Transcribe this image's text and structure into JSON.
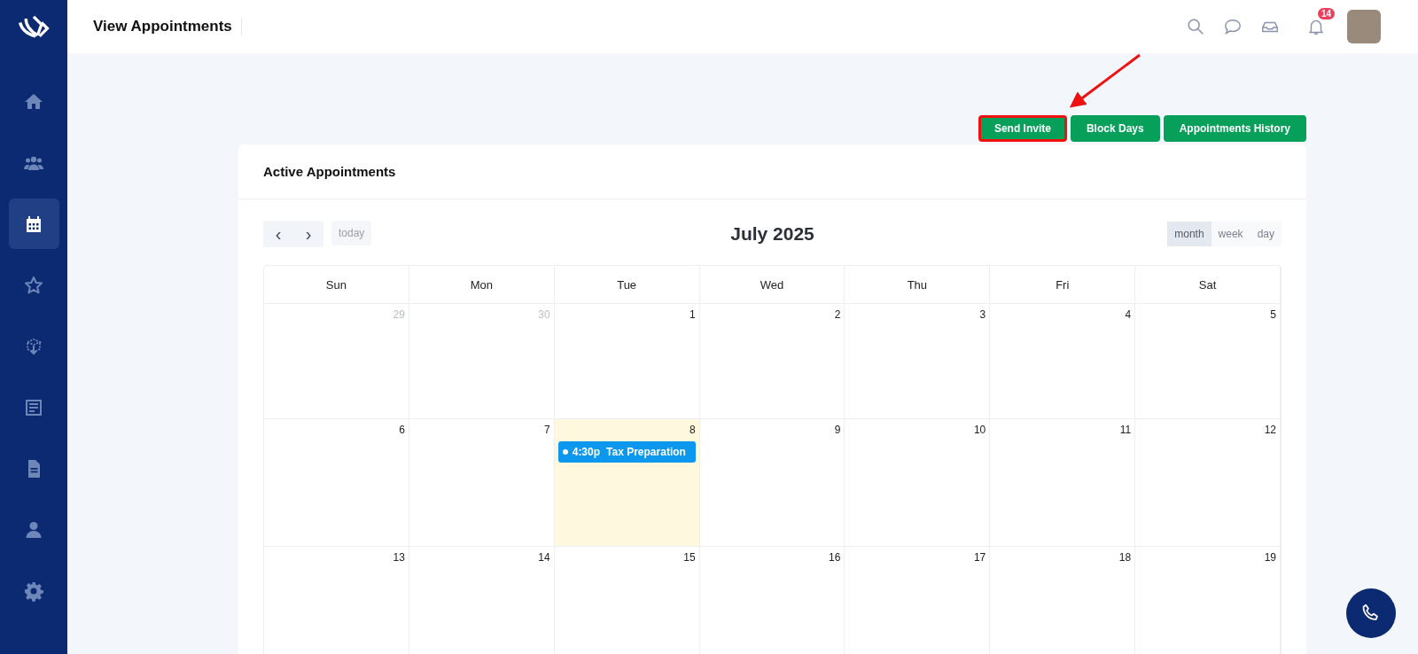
{
  "sidebar": {
    "items": [
      {
        "kind": "home",
        "selected": false
      },
      {
        "kind": "users",
        "selected": false
      },
      {
        "kind": "calendar",
        "selected": true
      },
      {
        "kind": "star",
        "selected": false
      },
      {
        "kind": "box",
        "selected": false
      },
      {
        "kind": "board",
        "selected": false
      },
      {
        "kind": "document",
        "selected": false
      },
      {
        "kind": "person",
        "selected": false
      },
      {
        "kind": "settings",
        "selected": false
      }
    ]
  },
  "header": {
    "title": "View Appointments",
    "notification_count": "14"
  },
  "actions": [
    {
      "label": "Send Invite",
      "highlighted": true
    },
    {
      "label": "Block Days",
      "highlighted": false
    },
    {
      "label": "Appointments History",
      "highlighted": false
    }
  ],
  "card": {
    "title": "Active Appointments"
  },
  "calendar": {
    "title": "July 2025",
    "prev": "‹",
    "next": "›",
    "today": "today",
    "views": [
      {
        "label": "month",
        "selected": true
      },
      {
        "label": "week",
        "selected": false
      },
      {
        "label": "day",
        "selected": false
      }
    ],
    "weekdays": [
      "Sun",
      "Mon",
      "Tue",
      "Wed",
      "Thu",
      "Fri",
      "Sat"
    ],
    "weeks": [
      [
        {
          "day": "29",
          "other_month": true,
          "today": false
        },
        {
          "day": "30",
          "other_month": true,
          "today": false
        },
        {
          "day": "1",
          "other_month": false,
          "today": false
        },
        {
          "day": "2",
          "other_month": false,
          "today": false
        },
        {
          "day": "3",
          "other_month": false,
          "today": false
        },
        {
          "day": "4",
          "other_month": false,
          "today": false
        },
        {
          "day": "5",
          "other_month": false,
          "today": false
        }
      ],
      [
        {
          "day": "6",
          "other_month": false,
          "today": false
        },
        {
          "day": "7",
          "other_month": false,
          "today": false
        },
        {
          "day": "8",
          "other_month": false,
          "today": true,
          "events": [
            {
              "time": "4:30p",
              "title": "Tax Preparation"
            }
          ]
        },
        {
          "day": "9",
          "other_month": false,
          "today": false
        },
        {
          "day": "10",
          "other_month": false,
          "today": false
        },
        {
          "day": "11",
          "other_month": false,
          "today": false
        },
        {
          "day": "12",
          "other_month": false,
          "today": false
        }
      ],
      [
        {
          "day": "13",
          "other_month": false,
          "today": false
        },
        {
          "day": "14",
          "other_month": false,
          "today": false
        },
        {
          "day": "15",
          "other_month": false,
          "today": false
        },
        {
          "day": "16",
          "other_month": false,
          "today": false
        },
        {
          "day": "17",
          "other_month": false,
          "today": false
        },
        {
          "day": "18",
          "other_month": false,
          "today": false
        },
        {
          "day": "19",
          "other_month": false,
          "today": false
        }
      ]
    ]
  }
}
